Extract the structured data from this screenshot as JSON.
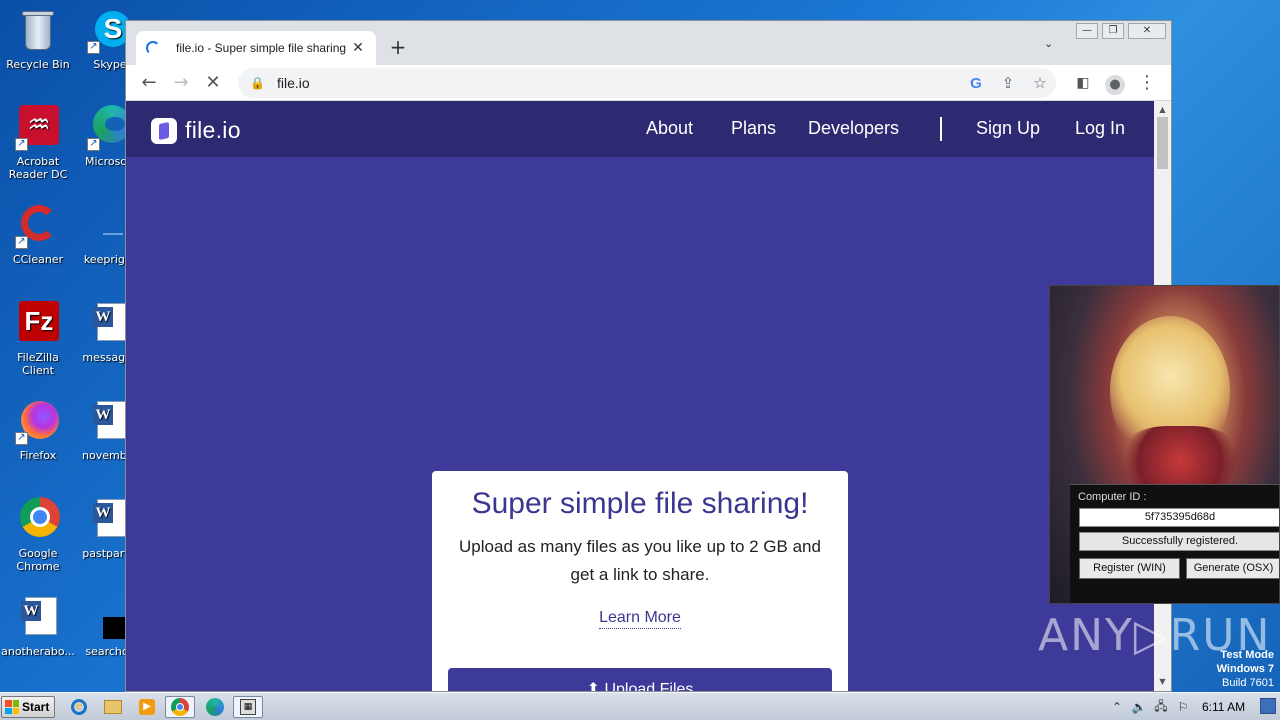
{
  "desktop": {
    "icons": [
      {
        "label": "Recycle Bin",
        "icon": "recycle-bin-icon"
      },
      {
        "label": "Skype",
        "icon": "skype-icon"
      },
      {
        "label": "Acrobat Reader DC",
        "icon": "acrobat-icon"
      },
      {
        "label": "Microsoft",
        "icon": "edge-icon"
      },
      {
        "label": "CCleaner",
        "icon": "ccleaner-icon"
      },
      {
        "label": "keepright",
        "icon": "blank-file-icon"
      },
      {
        "label": "FileZilla Client",
        "icon": "filezilla-icon"
      },
      {
        "label": "messages",
        "icon": "word-doc-icon"
      },
      {
        "label": "Firefox",
        "icon": "firefox-icon"
      },
      {
        "label": "november",
        "icon": "word-doc-icon"
      },
      {
        "label": "Google Chrome",
        "icon": "chrome-icon"
      },
      {
        "label": "pastpartic",
        "icon": "word-doc-icon"
      },
      {
        "label": "anotherabo...",
        "icon": "word-doc-icon"
      },
      {
        "label": "searchco",
        "icon": "black-file-icon"
      }
    ]
  },
  "browser": {
    "tab": {
      "title": "file.io - Super simple file sharing",
      "close": "✕"
    },
    "new_tab": "+",
    "url": "file.io",
    "window_controls": {
      "minimize": "—",
      "restore": "❐",
      "close": "✕"
    }
  },
  "site": {
    "logo_text": "file.io",
    "nav": {
      "about": "About",
      "plans": "Plans",
      "developers": "Developers",
      "signup": "Sign Up",
      "login": "Log In"
    },
    "card": {
      "headline": "Super simple file sharing!",
      "subtext": "Upload as many files as you like up to 2 GB and get a link to share.",
      "learn_more": "Learn More",
      "upload_button": "⬆ Upload Files"
    }
  },
  "keygen": {
    "computer_id_label": "Computer ID :",
    "computer_id": "5f735395d68d",
    "status": "Successfully registered.",
    "register_win": "Register (WIN)",
    "generate_osx": "Generate (OSX)"
  },
  "watermark": {
    "text": "ANY▷RUN",
    "test_mode": "Test Mode",
    "os": "Windows 7",
    "build": "Build 7601"
  },
  "taskbar": {
    "start_label": "Start",
    "clock": "6:11 AM",
    "colors": {
      "chrome_red": "#db4437",
      "chrome_green": "#0f9d58",
      "chrome_yellow": "#f4b400",
      "chrome_blue": "#4285f4"
    }
  }
}
